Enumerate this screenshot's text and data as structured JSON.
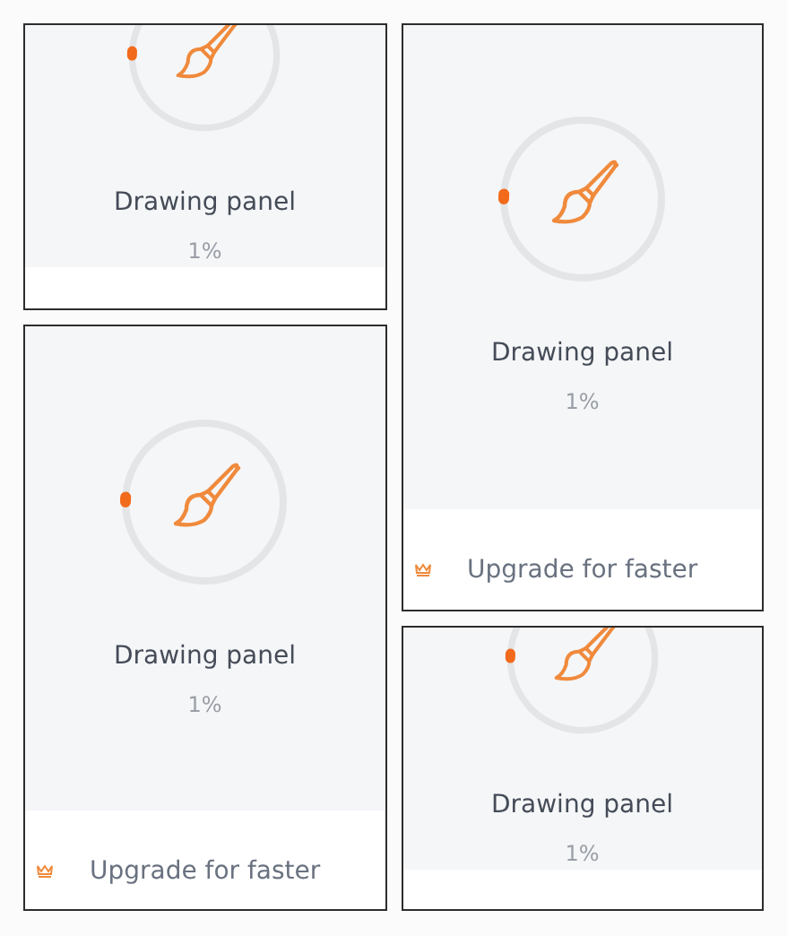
{
  "columns": [
    {
      "cards": [
        {
          "title": "Drawing panel",
          "progress": "1%",
          "level": 0.01
        },
        {
          "title": "Drawing panel",
          "progress": "1%",
          "level": 0.01,
          "upgrade": "Upgrade for faster"
        }
      ]
    },
    {
      "cards": [
        {
          "title": "Drawing panel",
          "progress": "1%",
          "level": 0.01,
          "upgrade": "Upgrade for faster"
        },
        {
          "title": "Drawing panel",
          "progress": "1%",
          "level": 0.01
        }
      ]
    }
  ]
}
